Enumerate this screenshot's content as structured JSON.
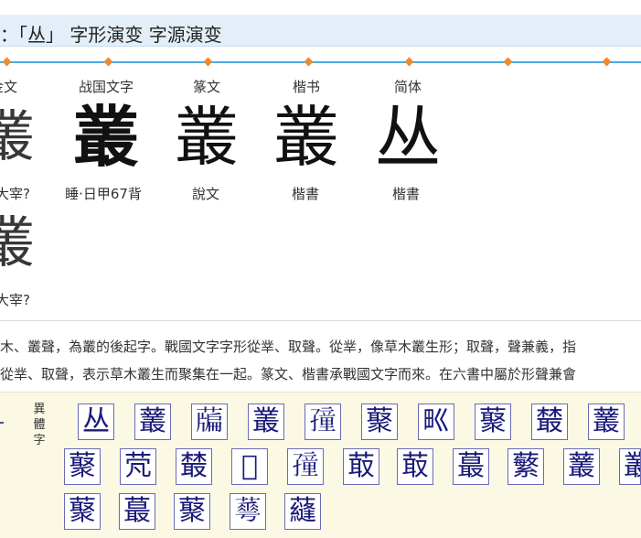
{
  "title": "：「丛」 字形演变 字源演变",
  "timeline_color": "#4fa9e6",
  "timeline_dot_color": "#f08a2c",
  "columns": [
    {
      "label": "金文",
      "glyph": "叢",
      "source": "大宰?"
    },
    {
      "label": "战国文字",
      "glyph": "叢",
      "source": "睡·日甲67背"
    },
    {
      "label": "篆文",
      "glyph": "叢",
      "source": "說文"
    },
    {
      "label": "楷书",
      "glyph": "叢",
      "source": "楷書"
    },
    {
      "label": "简体",
      "glyph": "丛",
      "source": "楷書"
    }
  ],
  "extra_glyph": {
    "glyph": "叢",
    "source": "大宰?"
  },
  "paragraph": [
    "木、叢聲，為叢的後起字。戰國文字字形從丵、取聲。從丵，像草木叢生形；取聲，聲兼義，指",
    "從丵、取聲，表示草木叢生而聚集在一起。篆文、楷書承戰國文字而來。在六書中屬於形聲兼會"
  ],
  "variants": {
    "label": "異體字",
    "rows": [
      [
        "丛",
        "䕺",
        "𦽃",
        "叢",
        "𡦜",
        "藂",
        "𤰕",
        "藂",
        "樷",
        "䕺"
      ],
      [
        "藂",
        "䒮",
        "樷",
        "𠦻",
        "𡦜",
        "菆",
        "菆",
        "蕞",
        "蘩",
        "䕺",
        "叢"
      ],
      [
        "藂",
        "蕞",
        "藂",
        "𦾓",
        "蘕"
      ]
    ]
  }
}
